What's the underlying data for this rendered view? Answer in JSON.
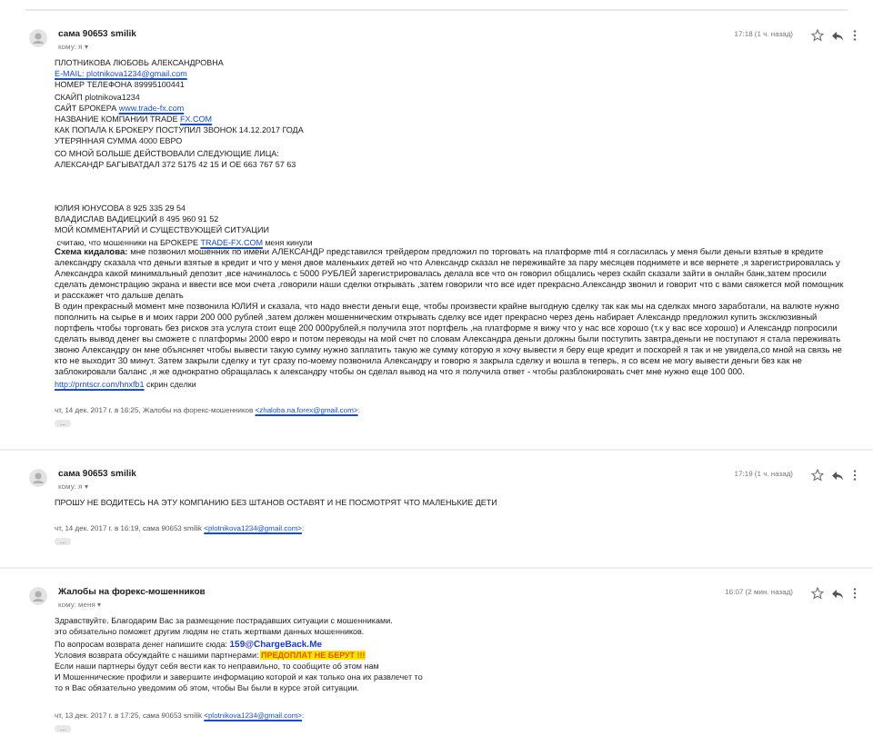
{
  "messages": [
    {
      "sender": "сама 90653 smilik",
      "recipient": "кому: я ▾",
      "time": "17:18 (1 ч. назад)",
      "starred": false,
      "body": [
        {
          "kind": "line",
          "parts": [
            {
              "kind": "plain",
              "text": "ПЛОТНИКОВА ЛЮБОВЬ АЛЕКСАНДРОВНА"
            }
          ]
        },
        {
          "kind": "line",
          "parts": [
            {
              "kind": "link",
              "text": "E-MAIL: plotnikova1234@gmail.com"
            }
          ]
        },
        {
          "kind": "line",
          "parts": [
            {
              "kind": "plain",
              "text": "НОМЕР ТЕЛЕФОНА 89995100441"
            }
          ]
        },
        {
          "kind": "line",
          "parts": [
            {
              "kind": "plain",
              "text": "СКАЙП plotnikova1234"
            }
          ]
        },
        {
          "kind": "line",
          "parts": [
            {
              "kind": "plain",
              "text": "САЙТ БРОКЕРА "
            },
            {
              "kind": "link",
              "text": "www.trade-fx.com"
            }
          ]
        },
        {
          "kind": "line",
          "parts": [
            {
              "kind": "plain",
              "text": "НАЗВАНИЕ КОМПАНИИ TRADE "
            },
            {
              "kind": "link",
              "text": "FX.COM"
            }
          ]
        },
        {
          "kind": "line",
          "parts": [
            {
              "kind": "plain",
              "text": "КАК ПОПАЛА К БРОКЕРУ ПОСТУПИЛ ЗВОНОК 14.12.2017 ГОДА"
            }
          ]
        },
        {
          "kind": "line",
          "parts": [
            {
              "kind": "plain",
              "text": "УТЕРЯННАЯ СУММА 4000 ЕВРО"
            }
          ]
        },
        {
          "kind": "line",
          "parts": [
            {
              "kind": "plain",
              "text": "СО МНОЙ БОЛЬШЕ ДЕЙСТВОВАЛИ СЛЕДУЮЩИЕ ЛИЦА:"
            }
          ]
        },
        {
          "kind": "line",
          "parts": [
            {
              "kind": "plain",
              "text": "АЛЕКСАНДР БАГЫВАТДАЛ 372 5175 42 15 И ОЕ 663 767 57 63"
            }
          ]
        },
        {
          "kind": "gap"
        },
        {
          "kind": "line",
          "parts": [
            {
              "kind": "plain",
              "text": "ЮЛИЯ ЮНУСОВА 8 925 335 29 54"
            }
          ]
        },
        {
          "kind": "line",
          "parts": [
            {
              "kind": "plain",
              "text": "ВЛАДИСЛАВ ВАДИЕЦКИЙ 8 495 960 91 52"
            }
          ]
        },
        {
          "kind": "line",
          "parts": [
            {
              "kind": "plain",
              "text": "МОЙ КОММЕНТАРИЙ И СУЩЕСТВУЮЩЕЙ СИТУАЦИИ"
            }
          ]
        },
        {
          "kind": "line",
          "parts": [
            {
              "kind": "plain",
              "text": " считаю, что мошенники на БРОКЕРЕ "
            },
            {
              "kind": "link",
              "text": "TRADE-FX.COM"
            },
            {
              "kind": "plain",
              "text": " меня кинули"
            }
          ]
        },
        {
          "kind": "paragraph",
          "text": "**Схема кидалова:** мне позвонил мошенник по имени АЛЕКСАНДР представился трейдером предложил по торговать на платформе mt4 я согласилась у меня были деньги взятые в кредите александру сказала что деньги взятые в кредит и что у меня двое маленьких детей но что Александр сказал не переживайте за пару месяцев поднимете и все вернете ,я зарегистрировалась у Александра какой минимальный депозит ,все начиналось с 5000 РУБЛЕЙ зарегистрировалась делала все что он говорил общались через скайп сказали зайти в онлайн банк,затем просили сделать демонстрацию экрана и ввести все мои счета ,говорили наши сделки открывать ,затем говорили что все идет прекрасно.Александр звонил и говорит что с вами свяжется мой помощник и расскажет что дальше делать"
        },
        {
          "kind": "paragraph",
          "text": " В один прекрасный момент мне позвонила ЮЛИЯ и сказала, что надо внести деньги еще, чтобы произвести крайне выгодную сделку так как мы на сделках много заработали, на валюте нужно пополнить на сырье в и моих гарри 200 000 рублей ,затем должен мошенническим открывать сделку все идет прекрасно через день набирает Александр  предложил купить эксклюзивный портфель чтобы торговать без рисков эта услуга стоит еще 200 000рублей,я получила этот портфель ,на платформе я вижу что у нас все хорошо (т.к у вас все хорошо) и Александр попросили сделать вывод денег вы сможете с платформы 2000 евро и потом переводы на мой счет по словам Александра деньги должны были поступить завтра,деньги не поступают я стала переживать звоню Александру он мне объясняет чтобы вывести такую сумму нужно заплатить такую же сумму которую я хочу вывести я беру еще кредит и поскорей я так и не увидела,со мной на связь не кто не выходит 30 минут. Затем закрыли сделку и тут сразу по-моему позвонила Александру и говорю я закрыла сделку и вошла в теперь, я со всем не могу вывести деньги без как не заблокировали баланс ,я же однократно обращалась к александру чтобы он сделал вывод на что я получила ответ - чтобы разблокировать счет мне нужно еще 100 000."
        },
        {
          "kind": "line",
          "parts": [
            {
              "kind": "link",
              "text": "http://prntscr.com/hnxfb1"
            },
            {
              "kind": "plain",
              "text": " скрин сделки"
            }
          ]
        }
      ],
      "quote": {
        "prefix": "чт, 14 дек. 2017 г. в 16:25, Жалобы на форекс-мошенников ",
        "address": "<zhaloba.na.forex@gmail.com>",
        "suffix": ":"
      },
      "trimmed": "..."
    },
    {
      "sender": "сама 90653 smilik",
      "recipient": "кому: я ▾",
      "time": "17:19 (1 ч. назад)",
      "starred": false,
      "body": [
        {
          "kind": "line",
          "parts": [
            {
              "kind": "plain",
              "text": "ПРОШУ НЕ ВОДИТЕСЬ НА ЭТУ КОМПАНИЮ БЕЗ ШТАНОВ ОСТАВЯТ И НЕ ПОСМОТРЯТ ЧТО МАЛЕНЬКИЕ ДЕТИ"
            }
          ]
        }
      ],
      "quote": {
        "prefix": "чт, 14 дек. 2017 г. в 16:19, сама 90653 smilik ",
        "address": "<plotnikova1234@gmail.com>",
        "suffix": ":"
      },
      "trimmed": "..."
    },
    {
      "sender": "Жалобы на форекс-мошенников",
      "recipient": "кому: меня ▾",
      "time": "16:07 (2 мин. назад)",
      "starred": false,
      "body": [
        {
          "kind": "line",
          "parts": [
            {
              "kind": "plain",
              "text": "Здравствуйте. Благодарим Вас за размещение пострадавших ситуации с мошенниками."
            }
          ]
        },
        {
          "kind": "line",
          "parts": [
            {
              "kind": "plain",
              "text": "это обязательно поможет другим людям не стать жертвами данных мошенников."
            }
          ]
        },
        {
          "kind": "line",
          "parts": [
            {
              "kind": "plain",
              "text": "По вопросам возврата денег напишите сюда: "
            },
            {
              "kind": "strong-link",
              "text": "159@ChargeBack.Me"
            }
          ]
        },
        {
          "kind": "line",
          "parts": [
            {
              "kind": "plain",
              "text": "Условия возврата обсуждайте с нашими партнерами: "
            },
            {
              "kind": "highlight",
              "text": "ПРЕДОПЛАТ НЕ БЕРУТ !!!"
            }
          ]
        },
        {
          "kind": "line",
          "parts": [
            {
              "kind": "plain",
              "text": "Если наши партнеры будут себя вести как то неправильно, то сообщите об этом нам"
            }
          ]
        },
        {
          "kind": "line",
          "parts": [
            {
              "kind": "plain",
              "text": "И Мошеннические профили и завершите информацию которой и как только она их развлечет то"
            }
          ]
        },
        {
          "kind": "line",
          "parts": [
            {
              "kind": "plain",
              "text": "то я Вас обязательно уведомим об этом, чтобы Вы были в курсе этой ситуации."
            }
          ]
        }
      ],
      "quote": {
        "prefix": "чт, 13 дек. 2017 г. в 17:25, сама 90653 smilik ",
        "address": "<plotnikova1234@gmail.com>",
        "suffix": ":"
      },
      "trimmed": "..."
    }
  ]
}
